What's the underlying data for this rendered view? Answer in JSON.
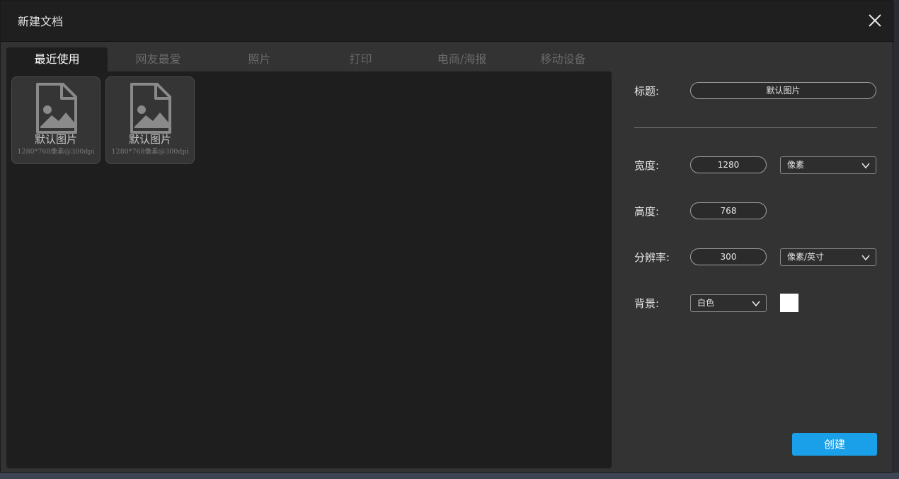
{
  "window": {
    "title": "新建文档"
  },
  "tabs": [
    {
      "label": "最近使用",
      "active": true
    },
    {
      "label": "网友最爱",
      "active": false
    },
    {
      "label": "照片",
      "active": false
    },
    {
      "label": "打印",
      "active": false
    },
    {
      "label": "电商/海报",
      "active": false
    },
    {
      "label": "移动设备",
      "active": false
    }
  ],
  "templates": [
    {
      "name": "默认图片",
      "meta": "1280*768像素@300dpi",
      "icon": "image-file-icon"
    },
    {
      "name": "默认图片",
      "meta": "1280*768像素@300dpi",
      "icon": "image-file-icon"
    }
  ],
  "form": {
    "title_label": "标题:",
    "title_value": "默认图片",
    "width_label": "宽度:",
    "width_value": "1280",
    "width_unit": "像素",
    "height_label": "高度:",
    "height_value": "768",
    "resolution_label": "分辨率:",
    "resolution_value": "300",
    "resolution_unit": "像素/英寸",
    "background_label": "背景:",
    "background_value": "白色",
    "background_color": "#ffffff"
  },
  "actions": {
    "create_label": "创建"
  },
  "colors": {
    "accent": "#1aa0e8",
    "panel": "#1e1e1e",
    "window": "#333333"
  }
}
